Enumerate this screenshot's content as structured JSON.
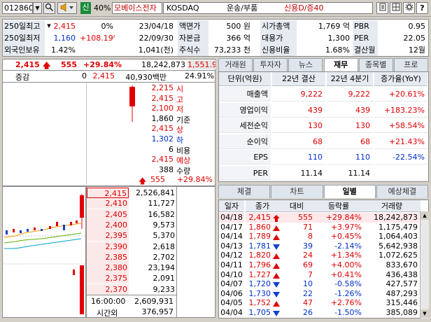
{
  "toolbar": {
    "code": "012860",
    "pct_badge": "신",
    "pct": "40%",
    "name": "모베이스전자",
    "market": "KOSDAQ",
    "sector": "운송/부품",
    "credit": "신용D/증40"
  },
  "info": {
    "rows": [
      {
        "label": "250일최고",
        "v1": "2,415",
        "v2": "0%",
        "v3": "23/04/18",
        "l2": "액면가",
        "v4": "500 원",
        "l3": "시가총액",
        "v5": "1,769 억",
        "l4": "PBR",
        "v6": "0.95"
      },
      {
        "label": "250일최저",
        "v1": "1,160",
        "v2": "+108.19%",
        "v3": "22/09/30",
        "l2": "자본금",
        "v4": "366 억",
        "l3": "대용가",
        "v5": "1,300",
        "l4": "PER",
        "v6": "22.05"
      },
      {
        "label": "외국인보유",
        "v1": "1.42%",
        "v2": "",
        "v3": "1,041(천)",
        "l2": "주식수",
        "v4": "73,233 천",
        "l3": "신용비율",
        "v5": "1.68%",
        "l4": "결산월",
        "v6": "12월"
      }
    ]
  },
  "quote": {
    "price": "2,415",
    "change": "555",
    "rate": "+29.84%",
    "volume": "18,242,873",
    "volratio": "1,551.9",
    "label_chg": "증감",
    "chg_val": "0",
    "price2": "2,415",
    "amount": "40,930백만",
    "ratio": "24.91%"
  },
  "summary": [
    {
      "v": "2,215",
      "k": "시",
      "c": "red"
    },
    {
      "v": "2,415",
      "k": "고",
      "c": "red"
    },
    {
      "v": "2,100",
      "k": "저",
      "c": "red"
    },
    {
      "v": "1,860",
      "k": "기준",
      "c": ""
    },
    {
      "v": "2,415",
      "k": "상",
      "c": "red"
    },
    {
      "v": "1,302",
      "k": "하",
      "c": "blue"
    },
    {
      "v": "6",
      "k": "비용",
      "c": ""
    },
    {
      "v": "2,415",
      "k": "예상",
      "c": "red"
    },
    {
      "v": "388",
      "k": "수량",
      "c": ""
    }
  ],
  "summary_footer": {
    "chg": "555",
    "rate": "+29.84%"
  },
  "orderbook": [
    {
      "p": "2,415",
      "q": "2,526,841"
    },
    {
      "p": "2,410",
      "q": "11,727"
    },
    {
      "p": "2,405",
      "q": "16,582"
    },
    {
      "p": "2,400",
      "q": "9,573"
    },
    {
      "p": "2,395",
      "q": "5,370"
    },
    {
      "p": "2,390",
      "q": "2,618"
    },
    {
      "p": "2,385",
      "q": "2,702"
    },
    {
      "p": "2,380",
      "q": "23,194"
    },
    {
      "p": "2,375",
      "q": "2,091"
    },
    {
      "p": "2,370",
      "q": "9,233"
    }
  ],
  "orderbook_footer": {
    "time": "16:00:00",
    "total": "2,609,931",
    "after_label": "시간외",
    "after": "376,957"
  },
  "tabs_top": [
    "거래원",
    "투자자",
    "뉴스",
    "재무",
    "종목별",
    "프로"
  ],
  "fin": {
    "headers": [
      "단위(억원)",
      "22년 결산",
      "22년 4분기",
      "증가율(YoY)"
    ],
    "rows": [
      {
        "k": "매출액",
        "a": "9,222",
        "b": "9,222",
        "g": "+20.61%",
        "c": "red"
      },
      {
        "k": "영업이익",
        "a": "439",
        "b": "439",
        "g": "+183.23%",
        "c": "red"
      },
      {
        "k": "세전순익",
        "a": "130",
        "b": "130",
        "g": "+58.54%",
        "c": "red"
      },
      {
        "k": "순이익",
        "a": "68",
        "b": "68",
        "g": "+21.43%",
        "c": "red"
      },
      {
        "k": "EPS",
        "a": "110",
        "b": "110",
        "g": "-22.54%",
        "c": "blue"
      },
      {
        "k": "PER",
        "a": "11.14",
        "b": "11.14",
        "g": "",
        "c": ""
      }
    ]
  },
  "tabs_bottom": [
    "체결",
    "차트",
    "일별",
    "예상체결"
  ],
  "daily": {
    "headers": [
      "일자",
      "종가",
      "대비",
      "등락률",
      "거래량"
    ],
    "rows": [
      {
        "d": "04/18",
        "p": "2,415",
        "dir": "up",
        "ch": "555",
        "r": "+29.84%",
        "v": "18,242,873"
      },
      {
        "d": "04/17",
        "p": "1,860",
        "dir": "up",
        "ch": "71",
        "r": "+3.97%",
        "v": "1,175,479"
      },
      {
        "d": "04/14",
        "p": "1,789",
        "dir": "up",
        "ch": "8",
        "r": "+0.45%",
        "v": "1,064,403"
      },
      {
        "d": "04/13",
        "p": "1,781",
        "dir": "down",
        "ch": "39",
        "r": "-2.14%",
        "v": "5,642,938"
      },
      {
        "d": "04/12",
        "p": "1,820",
        "dir": "up",
        "ch": "24",
        "r": "+1.34%",
        "v": "1,072,625"
      },
      {
        "d": "04/11",
        "p": "1,796",
        "dir": "up",
        "ch": "69",
        "r": "+4.00%",
        "v": "833,670"
      },
      {
        "d": "04/10",
        "p": "1,727",
        "dir": "up",
        "ch": "7",
        "r": "+0.41%",
        "v": "436,438"
      },
      {
        "d": "04/07",
        "p": "1,720",
        "dir": "down",
        "ch": "10",
        "r": "-0.58%",
        "v": "427,577"
      },
      {
        "d": "04/06",
        "p": "1,730",
        "dir": "down",
        "ch": "22",
        "r": "-1.26%",
        "v": "487,293"
      },
      {
        "d": "04/05",
        "p": "1,752",
        "dir": "up",
        "ch": "47",
        "r": "+2.76%",
        "v": "315,446"
      },
      {
        "d": "04/04",
        "p": "1,705",
        "dir": "down",
        "ch": "26",
        "r": "-1.50%",
        "v": "385,089"
      }
    ]
  }
}
